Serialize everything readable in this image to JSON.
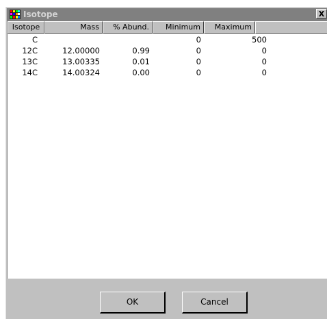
{
  "window": {
    "title": "Isotope",
    "close_label": "X"
  },
  "columns": [
    "Isotope",
    "Mass",
    "% Abund.",
    "Minimum",
    "Maximum"
  ],
  "rows": [
    {
      "isotope": "C",
      "mass": "",
      "abund": "",
      "min": "0",
      "max": "500"
    },
    {
      "isotope": "12C",
      "mass": "12.00000",
      "abund": "0.99",
      "min": "0",
      "max": "0"
    },
    {
      "isotope": "13C",
      "mass": "13.00335",
      "abund": "0.01",
      "min": "0",
      "max": "0"
    },
    {
      "isotope": "14C",
      "mass": "14.00324",
      "abund": "0.00",
      "min": "0",
      "max": "0"
    }
  ],
  "buttons": {
    "ok": "OK",
    "cancel": "Cancel"
  },
  "icons": {
    "app": "isotope-app-icon",
    "close": "close-icon"
  }
}
